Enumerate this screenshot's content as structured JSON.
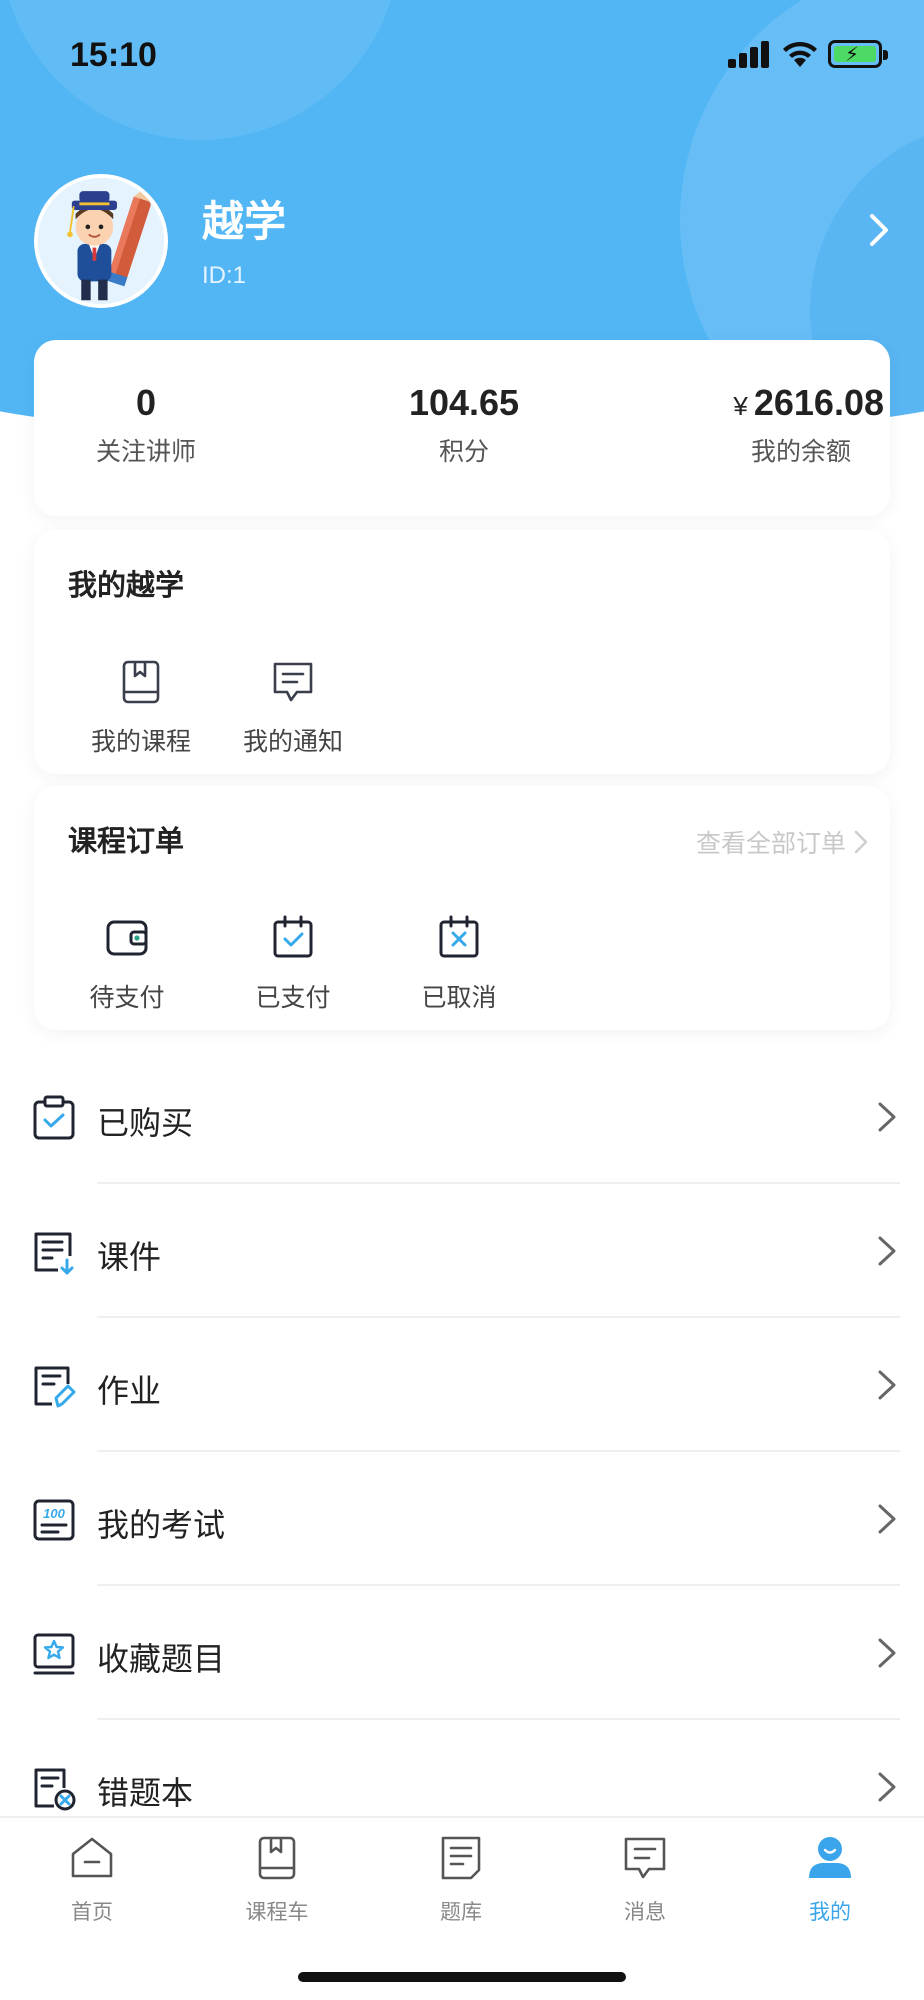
{
  "status_bar": {
    "time": "15:10"
  },
  "profile": {
    "name": "越学",
    "id_text": "ID:1"
  },
  "stats": [
    {
      "value": "0",
      "label": "关注讲师"
    },
    {
      "value": "104.65",
      "label": "积分"
    },
    {
      "currency": "¥",
      "value": "2616.08",
      "label": "我的余额"
    }
  ],
  "my_section": {
    "title": "我的越学",
    "items": [
      {
        "label": "我的课程",
        "icon": "book-icon"
      },
      {
        "label": "我的通知",
        "icon": "notification-icon"
      }
    ]
  },
  "orders": {
    "title": "课程订单",
    "view_all": "查看全部订单",
    "items": [
      {
        "label": "待支付",
        "icon": "wallet-icon"
      },
      {
        "label": "已支付",
        "icon": "calendar-check-icon"
      },
      {
        "label": "已取消",
        "icon": "calendar-x-icon"
      }
    ]
  },
  "menu": [
    {
      "label": "已购买",
      "icon": "purchased-icon"
    },
    {
      "label": "课件",
      "icon": "courseware-icon"
    },
    {
      "label": "作业",
      "icon": "homework-icon"
    },
    {
      "label": "我的考试",
      "icon": "exam-icon"
    },
    {
      "label": "收藏题目",
      "icon": "favorite-questions-icon"
    },
    {
      "label": "错题本",
      "icon": "wrong-questions-icon"
    }
  ],
  "tabs": [
    {
      "label": "首页",
      "icon": "home-icon"
    },
    {
      "label": "课程车",
      "icon": "course-cart-icon"
    },
    {
      "label": "题库",
      "icon": "question-bank-icon"
    },
    {
      "label": "消息",
      "icon": "message-icon"
    },
    {
      "label": "我的",
      "icon": "profile-icon",
      "active": true
    }
  ],
  "colors": {
    "accent": "#3ba5ec",
    "header": "#52b6f5",
    "icon_line": "#3a3f4b"
  }
}
